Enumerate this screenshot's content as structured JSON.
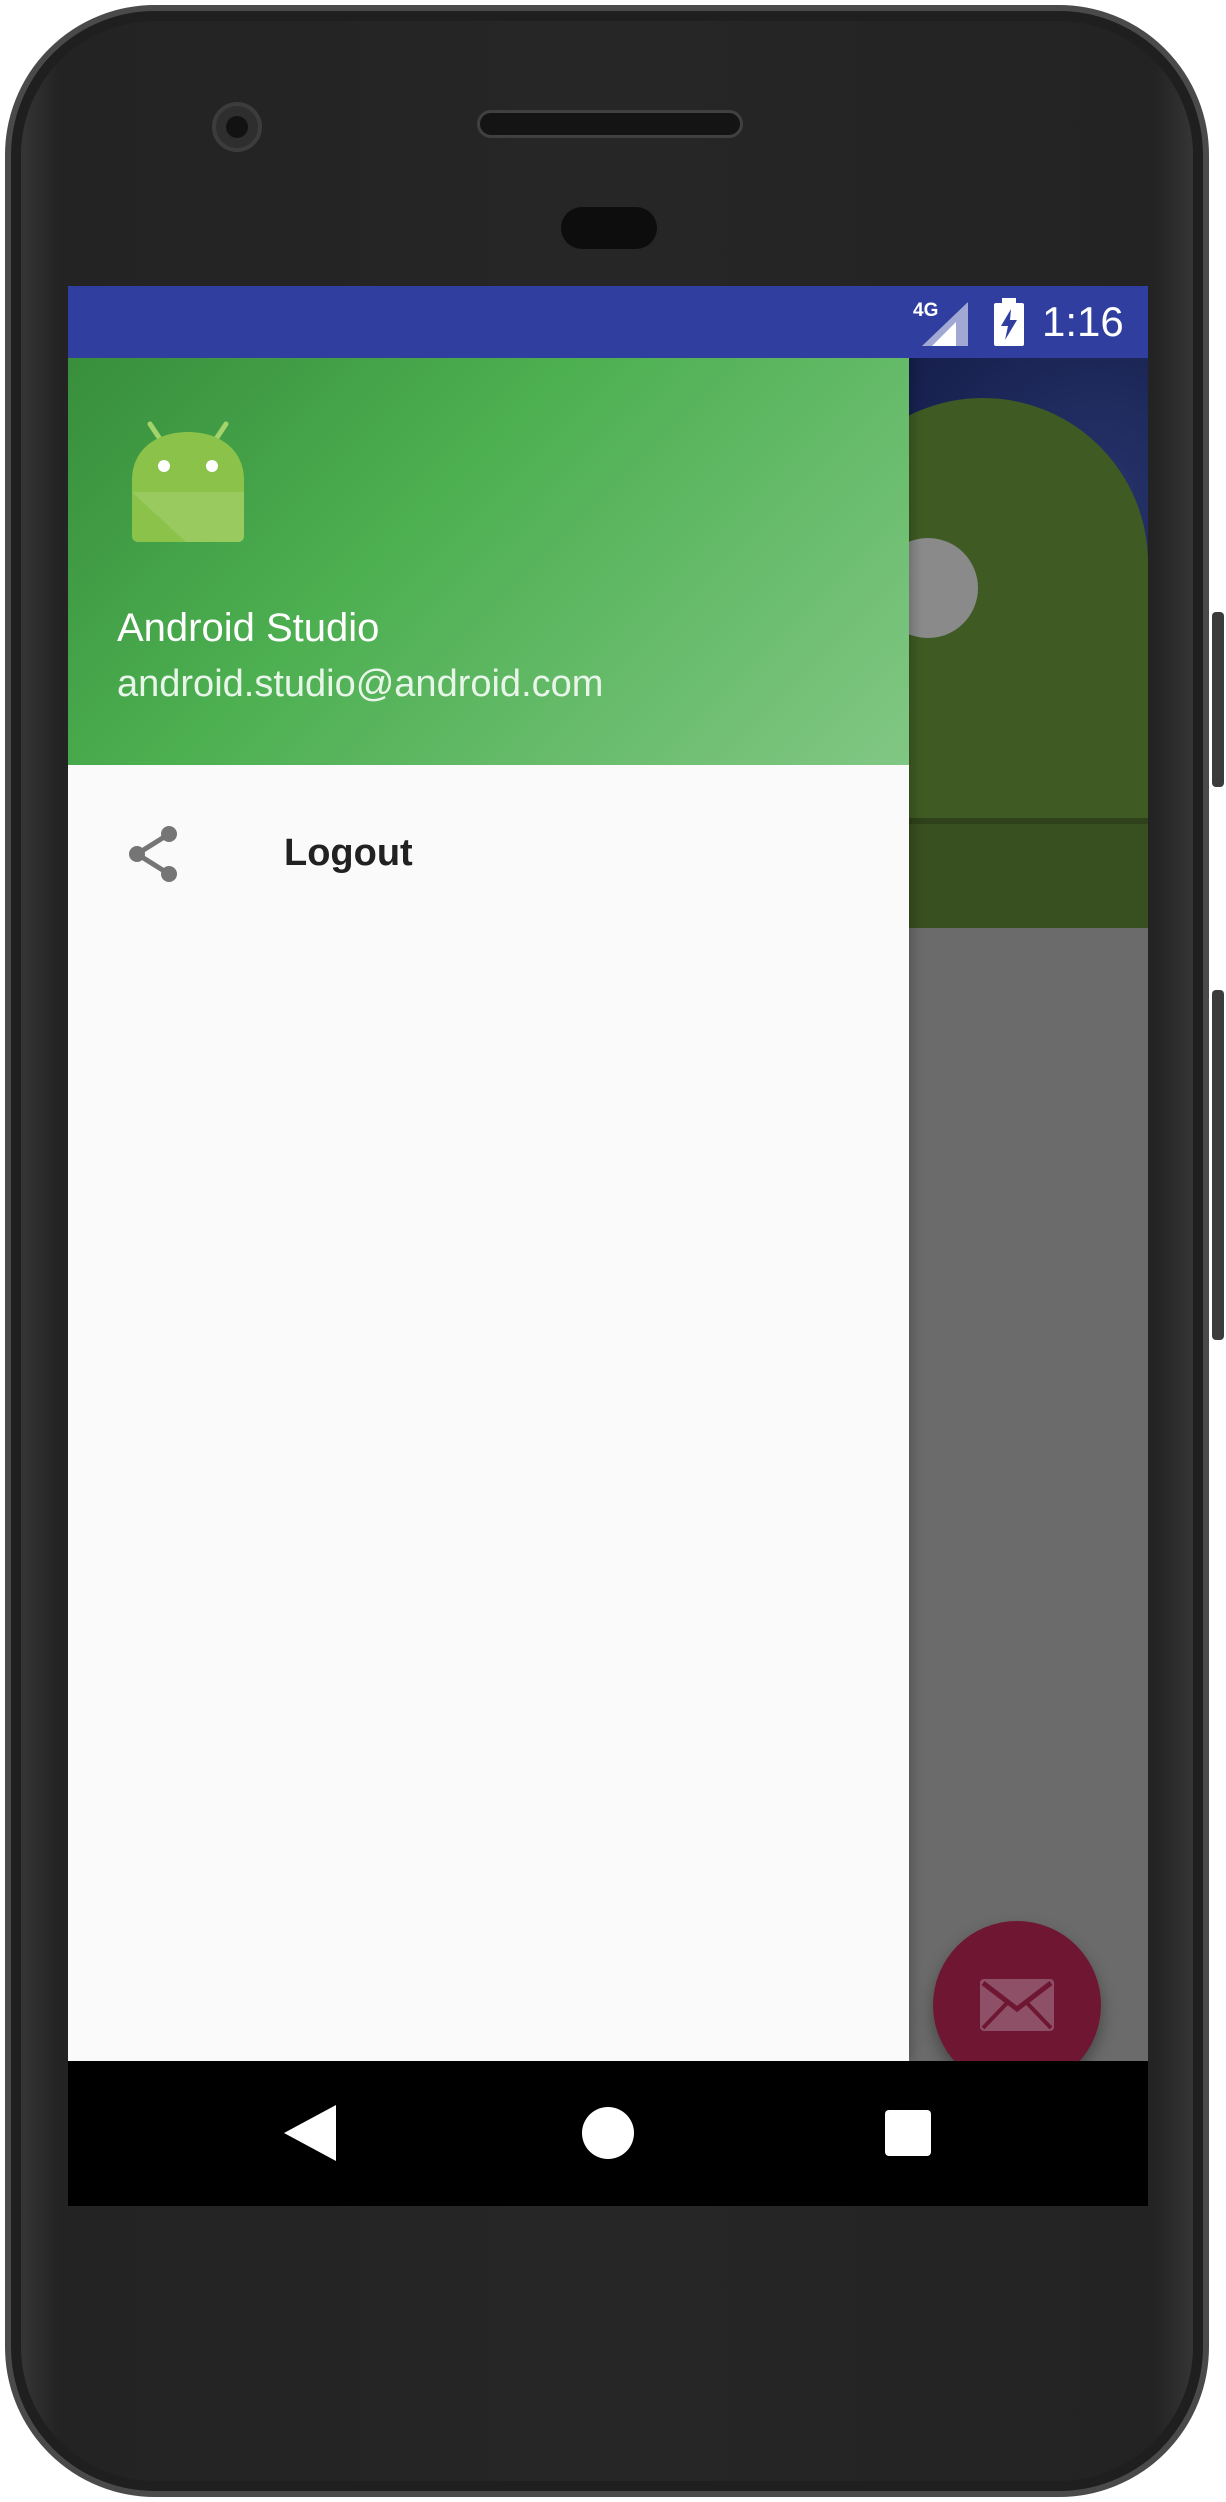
{
  "status_bar": {
    "network": "4G",
    "time": "1:16",
    "color": "#303f9f"
  },
  "drawer": {
    "header": {
      "user_name": "Android Studio",
      "user_email": "android.studio@android.com",
      "avatar_icon": "android-icon"
    },
    "menu_items": [
      {
        "label": "Logout",
        "icon": "share-icon"
      }
    ]
  },
  "fab": {
    "icon": "mail-icon",
    "color": "#6f1632"
  },
  "navigation_bar": {
    "buttons": [
      "back-button",
      "home-button",
      "recents-button"
    ]
  },
  "colors": {
    "primary": "#303f9f",
    "drawer_header_green": "#4caf50"
  }
}
